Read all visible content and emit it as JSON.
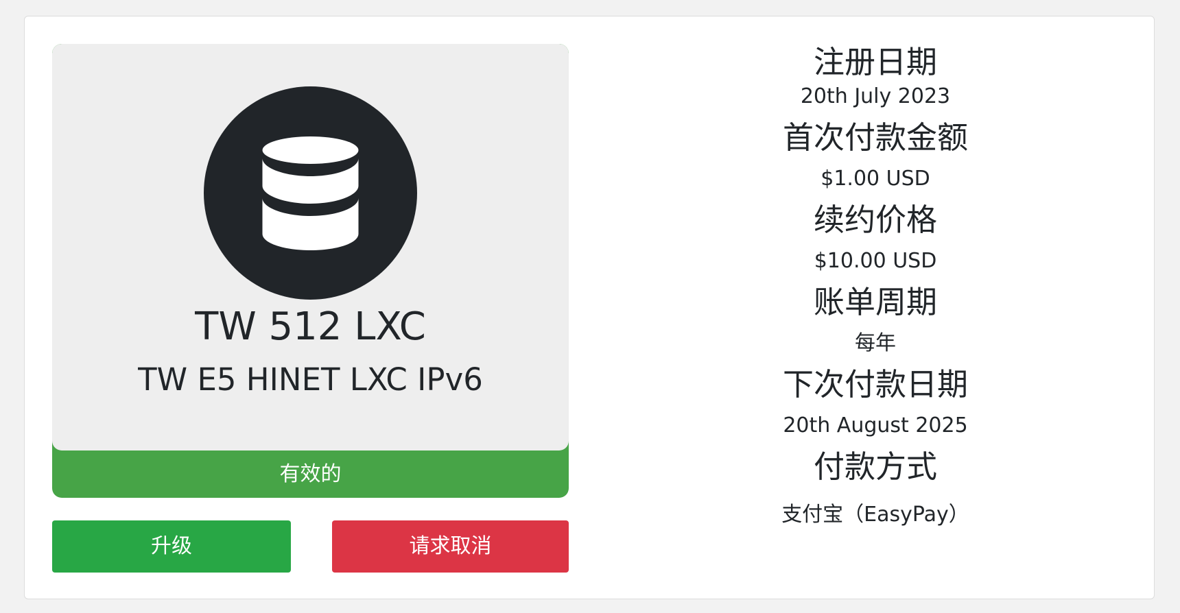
{
  "product": {
    "icon": "database-icon",
    "name": "TW 512 LXC",
    "group": "TW E5 HINET LXC IPv6",
    "status": "有效的",
    "status_color": "#47a447"
  },
  "actions": {
    "upgrade_label": "升级",
    "upgrade_color": "#28a745",
    "cancel_label": "请求取消",
    "cancel_color": "#dc3545"
  },
  "details": [
    {
      "title": "注册日期",
      "value": "20th July 2023"
    },
    {
      "title": "首次付款金额",
      "value": "$1.00 USD"
    },
    {
      "title": "续约价格",
      "value": "$10.00 USD"
    },
    {
      "title": "账单周期",
      "value": "每年"
    },
    {
      "title": "下次付款日期",
      "value": "20th August 2025"
    },
    {
      "title": "付款方式",
      "value": "支付宝（EasyPay）"
    }
  ]
}
